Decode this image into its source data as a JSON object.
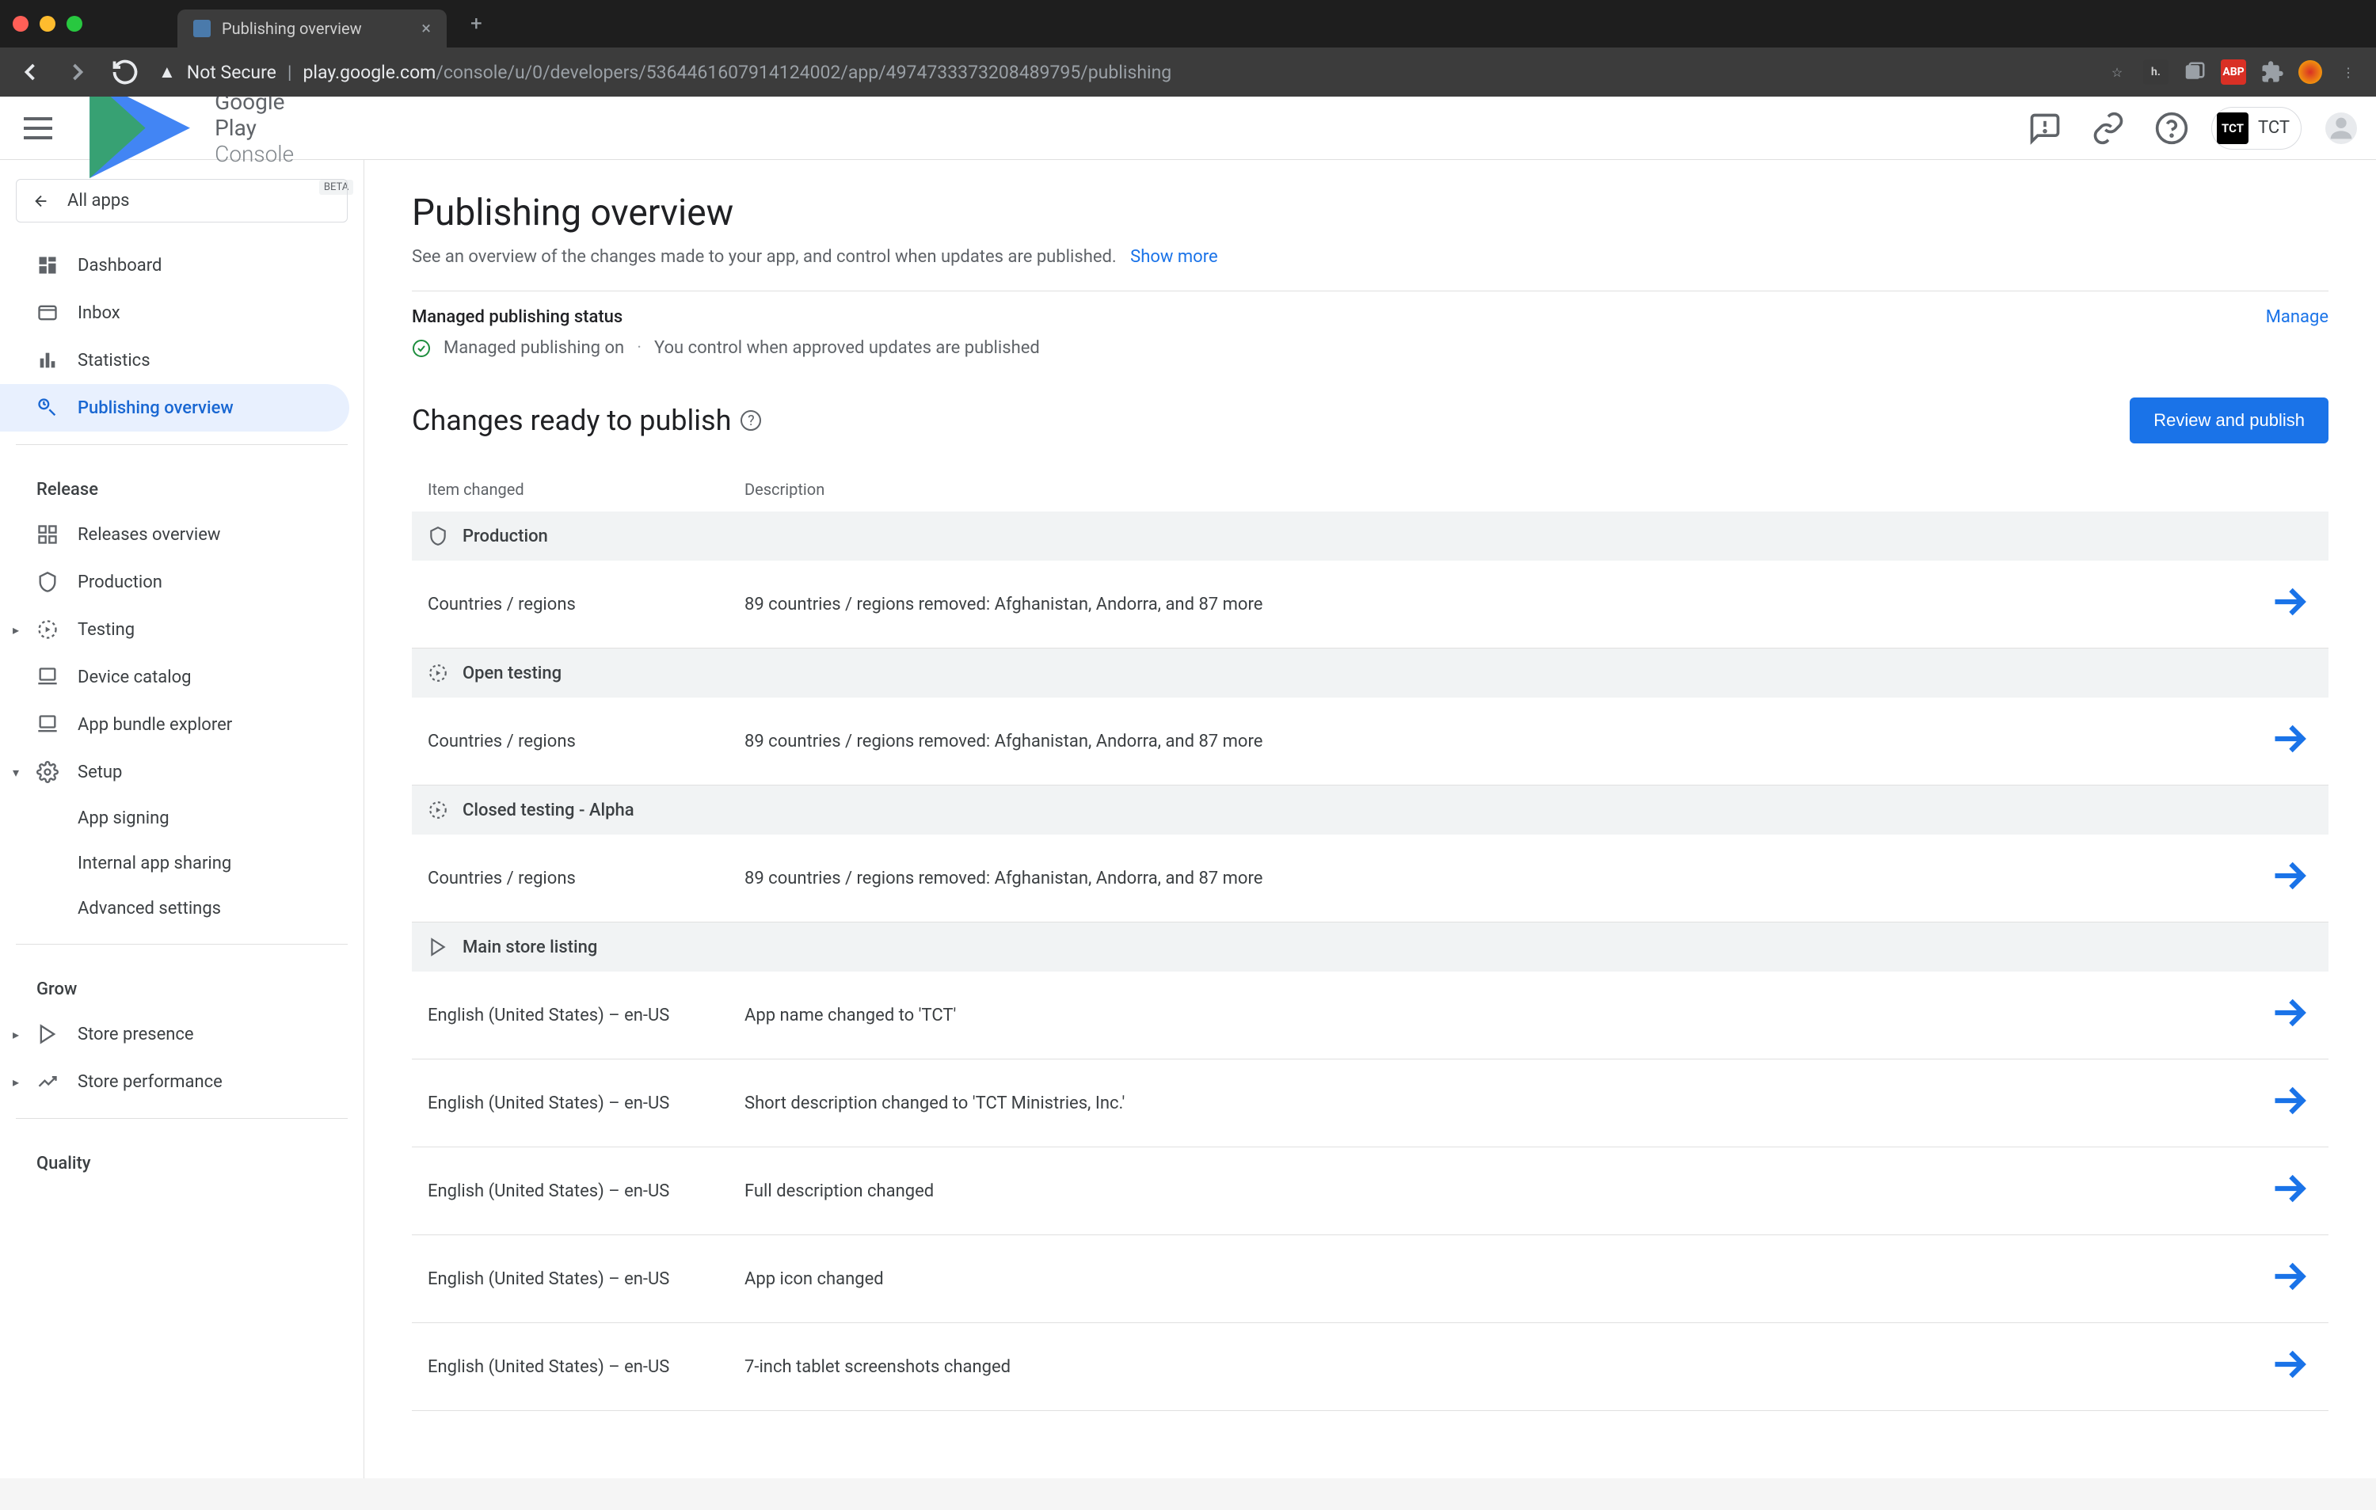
{
  "browser": {
    "tab_title": "Publishing overview",
    "not_secure": "Not Secure",
    "url_host": "play.google.com",
    "url_path": "/console/u/0/developers/5364461607914124002/app/4974733373208489795/publishing"
  },
  "header": {
    "brand1": "Google Play",
    "brand2": " Console",
    "beta": "BETA",
    "account_short": "TCT",
    "account_label": "TCT"
  },
  "sidebar": {
    "all_apps": "All apps",
    "items": [
      {
        "label": "Dashboard"
      },
      {
        "label": "Inbox"
      },
      {
        "label": "Statistics"
      },
      {
        "label": "Publishing overview",
        "active": true
      }
    ],
    "release_heading": "Release",
    "release": [
      {
        "label": "Releases overview"
      },
      {
        "label": "Production"
      },
      {
        "label": "Testing",
        "expandable": true
      },
      {
        "label": "Device catalog"
      },
      {
        "label": "App bundle explorer"
      },
      {
        "label": "Setup",
        "expandable": true,
        "expanded": true
      }
    ],
    "setup_children": [
      {
        "label": "App signing"
      },
      {
        "label": "Internal app sharing"
      },
      {
        "label": "Advanced settings"
      }
    ],
    "grow_heading": "Grow",
    "grow": [
      {
        "label": "Store presence",
        "expandable": true
      },
      {
        "label": "Store performance",
        "expandable": true
      }
    ],
    "quality_heading": "Quality"
  },
  "main": {
    "title": "Publishing overview",
    "subtitle": "See an overview of the changes made to your app, and control when updates are published.",
    "show_more": "Show more",
    "mp_heading": "Managed publishing status",
    "mp_manage": "Manage",
    "mp_on": "Managed publishing on",
    "mp_desc": "You control when approved updates are published",
    "changes_title": "Changes ready to publish",
    "review_btn": "Review and publish",
    "table": {
      "col_item": "Item changed",
      "col_desc": "Description",
      "groups": [
        {
          "label": "Production",
          "icon": "production",
          "rows": [
            {
              "item": "Countries / regions",
              "desc": "89 countries / regions removed: Afghanistan, Andorra, and 87 more"
            }
          ]
        },
        {
          "label": "Open testing",
          "icon": "testing",
          "rows": [
            {
              "item": "Countries / regions",
              "desc": "89 countries / regions removed: Afghanistan, Andorra, and 87 more"
            }
          ]
        },
        {
          "label": "Closed testing - Alpha",
          "icon": "testing",
          "rows": [
            {
              "item": "Countries / regions",
              "desc": "89 countries / regions removed: Afghanistan, Andorra, and 87 more"
            }
          ]
        },
        {
          "label": "Main store listing",
          "icon": "store",
          "rows": [
            {
              "item": "English (United States) – en-US",
              "desc": "App name changed to 'TCT'"
            },
            {
              "item": "English (United States) – en-US",
              "desc": "Short description changed to 'TCT Ministries, Inc.'"
            },
            {
              "item": "English (United States) – en-US",
              "desc": "Full description changed"
            },
            {
              "item": "English (United States) – en-US",
              "desc": "App icon changed"
            },
            {
              "item": "English (United States) – en-US",
              "desc": "7-inch tablet screenshots changed"
            }
          ]
        }
      ]
    }
  }
}
